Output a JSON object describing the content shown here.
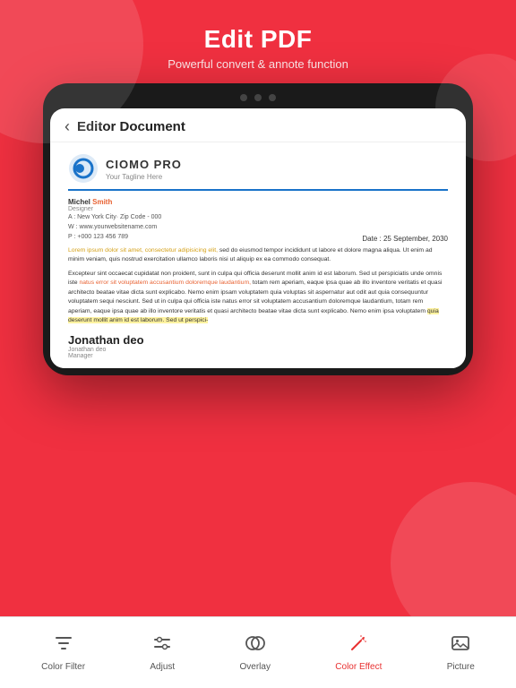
{
  "background_color": "#f03040",
  "header": {
    "title": "Edit PDF",
    "subtitle": "Powerful convert & annote function"
  },
  "device": {
    "dots": [
      1,
      2,
      3
    ]
  },
  "screen": {
    "navbar": {
      "back_label": "‹",
      "title": "Editor Document"
    },
    "logo": {
      "company": "CIOMO PRO",
      "tagline": "Your Tagline Here"
    },
    "contact": {
      "name": "Michel",
      "name_highlight": "Smith",
      "role": "Designer",
      "address_label": "A :",
      "address": "New York City· Zip Code - 000",
      "website_label": "W :",
      "website": "www.yourwebsitename.com",
      "phone_label": "P :",
      "phone": "+000 123 456 789",
      "date": "Date : 25 September, 2030"
    },
    "paragraph1": "Lorem ipsum dolor sit amet, consectetur adipisicing elit, sed do eiusmod tempor incididunt ut labore et dolore magna aliqua. Ut enim ad minim veniam, quis nostrud exercitation ullamco laboris nisi ut aliquip ex ea commodo consequat.",
    "paragraph2": "Excepteur sint occaecat cupidatat non proident, sunt in culpa qui officia deserunt mollit anim id est laborum. Sed ut perspiciatis unde omnis iste natus error sit voluptatem accusantium doloremque laudantium, totam rem aperiam, eaque ipsa quae ab illo inventore veritatis et quasi architecto beatae vitae dicta sunt explicabo. Nemo enim ipsam voluptatem quia voluptas sit aspernatur aut odit aut quia consequuntur voluptatem sequi nesciunt. Sed ut in culpa qui officia iste natus error sit voluptatem accusantium doloremque laudantium, totam rem aperiam, eaque ipsa quae ab illo inventore veritatis et quasi architecto beatae vitae dicta sunt explicabo. Nemo enim ipsa voluptatem quia deserunt mollit anim id est laborum. Sed ut perspici-",
    "signature": {
      "name": "Jonathan deo",
      "sub1": "Jonathan deo",
      "sub2": "Manager"
    }
  },
  "toolbar": {
    "items": [
      {
        "id": "color-filter",
        "label": "Color Filter",
        "icon": "funnel"
      },
      {
        "id": "adjust",
        "label": "Adjust",
        "icon": "sliders"
      },
      {
        "id": "overlay",
        "label": "Overlay",
        "icon": "circles"
      },
      {
        "id": "color-effect",
        "label": "Color Effect",
        "icon": "magic",
        "active": true
      },
      {
        "id": "picture",
        "label": "Picture",
        "icon": "image"
      }
    ]
  }
}
